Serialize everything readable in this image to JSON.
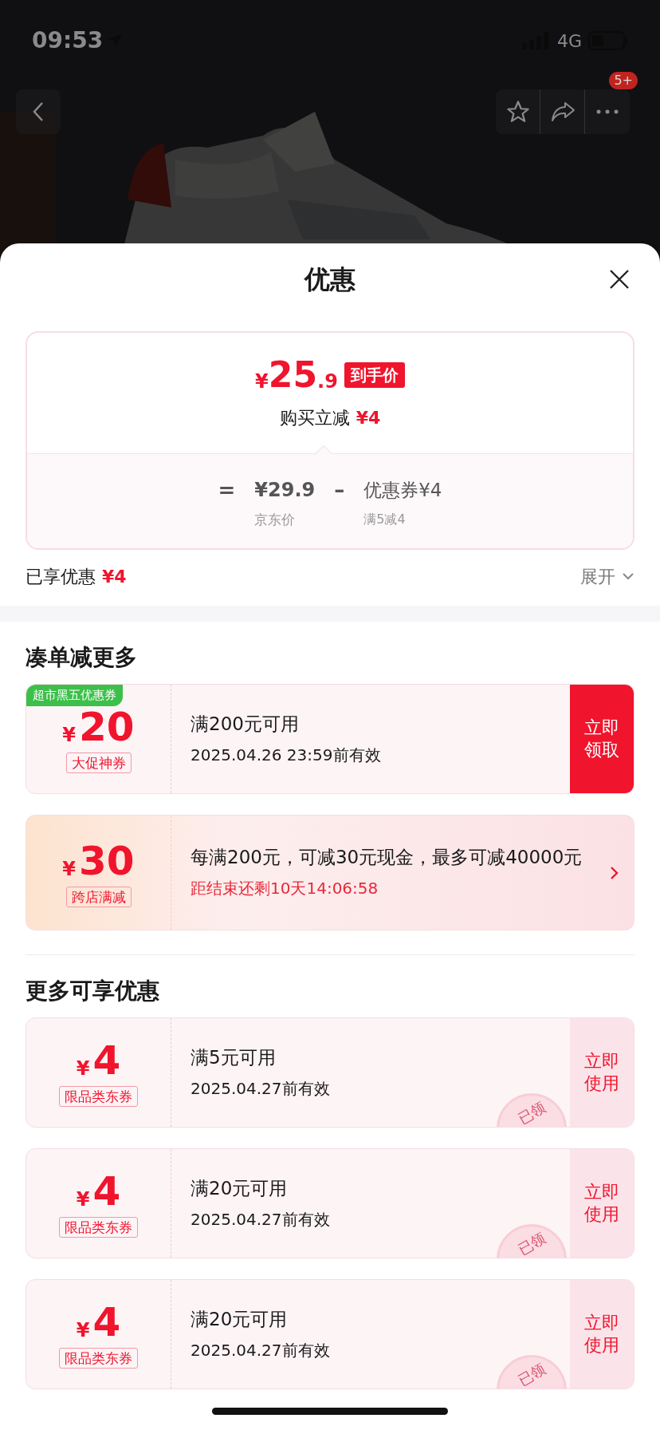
{
  "status_bar": {
    "time": "09:53",
    "network": "4G"
  },
  "top_actions": {
    "badge": "5+"
  },
  "sheet": {
    "title": "优惠"
  },
  "price_card": {
    "currency": "¥",
    "price_int": "25",
    "price_dec": ".9",
    "price_tag": "到手价",
    "instant_label": "购买立减",
    "instant_amount": "¥4",
    "equals": "=",
    "base_price": "¥29.9",
    "base_label": "京东价",
    "minus": "–",
    "coupon_part": "优惠券¥4",
    "coupon_label": "满5减4"
  },
  "enjoyed": {
    "label": "已享优惠",
    "amount": "¥4",
    "toggle": "展开"
  },
  "sections": [
    {
      "title": "凑单减更多",
      "coupons": [
        {
          "kind": "claim",
          "corner_tag": "超市黑五优惠券",
          "currency": "¥",
          "amount": "20",
          "tag": "大促神券",
          "condition": "满200元可用",
          "validity": "2025.04.26 23:59前有效",
          "action": "立即领取",
          "claimed": false
        },
        {
          "kind": "promo",
          "currency": "¥",
          "amount": "30",
          "tag": "跨店满减",
          "condition": "每满200元，可减30元现金，最多可减40000元",
          "countdown": "距结束还剩10天14:06:58"
        }
      ]
    },
    {
      "title": "更多可享优惠",
      "coupons": [
        {
          "kind": "use",
          "currency": "¥",
          "amount": "4",
          "tag": "限品类东券",
          "condition": "满5元可用",
          "validity": "2025.04.27前有效",
          "action": "立即使用",
          "claimed": true,
          "stamp": "已领"
        },
        {
          "kind": "use",
          "currency": "¥",
          "amount": "4",
          "tag": "限品类东券",
          "condition": "满20元可用",
          "validity": "2025.04.27前有效",
          "action": "立即使用",
          "claimed": true,
          "stamp": "已领"
        },
        {
          "kind": "use",
          "currency": "¥",
          "amount": "4",
          "tag": "限品类东券",
          "condition": "满20元可用",
          "validity": "2025.04.27前有效",
          "action": "立即使用",
          "claimed": true,
          "stamp": "已领"
        }
      ]
    }
  ]
}
